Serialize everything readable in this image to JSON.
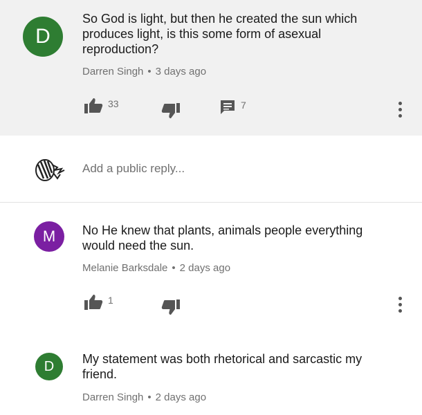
{
  "comment": {
    "avatar_letter": "D",
    "avatar_color": "#2e7d32",
    "text_lines": [
      "So God is light, but then he created the sun which",
      "produces light, is this some form of asexual",
      "reproduction?"
    ],
    "author": "Darren Singh",
    "separator": "•",
    "time": "3 days ago",
    "like_count": "33",
    "reply_count": "7"
  },
  "reply_box": {
    "placeholder": "Add a public reply..."
  },
  "replies": [
    {
      "avatar_letter": "M",
      "avatar_color": "#7b1fa2",
      "text_lines": [
        "No He knew that plants, animals people everything",
        "would need the sun."
      ],
      "author": "Melanie Barksdale",
      "separator": "•",
      "time": "2 days ago",
      "like_count": "1"
    },
    {
      "avatar_letter": "D",
      "avatar_color": "#2e7d32",
      "text_lines": [
        "My statement was both rhetorical and sarcastic my",
        "friend."
      ],
      "author": "Darren Singh",
      "separator": "•",
      "time": "2 days ago"
    }
  ],
  "icons": {
    "like": "thumbs-up-icon",
    "dislike": "thumbs-down-icon",
    "reply": "comment-icon",
    "more": "more-vert-icon"
  }
}
